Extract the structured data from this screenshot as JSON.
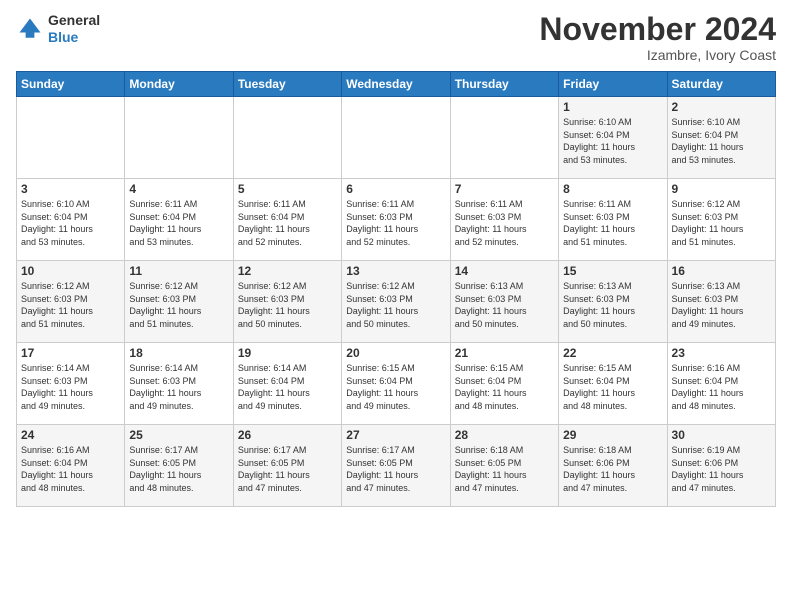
{
  "header": {
    "logo_general": "General",
    "logo_blue": "Blue",
    "month_title": "November 2024",
    "location": "Izambre, Ivory Coast"
  },
  "weekdays": [
    "Sunday",
    "Monday",
    "Tuesday",
    "Wednesday",
    "Thursday",
    "Friday",
    "Saturday"
  ],
  "weeks": [
    {
      "days": [
        {
          "num": "",
          "info": ""
        },
        {
          "num": "",
          "info": ""
        },
        {
          "num": "",
          "info": ""
        },
        {
          "num": "",
          "info": ""
        },
        {
          "num": "",
          "info": ""
        },
        {
          "num": "1",
          "info": "Sunrise: 6:10 AM\nSunset: 6:04 PM\nDaylight: 11 hours\nand 53 minutes."
        },
        {
          "num": "2",
          "info": "Sunrise: 6:10 AM\nSunset: 6:04 PM\nDaylight: 11 hours\nand 53 minutes."
        }
      ]
    },
    {
      "days": [
        {
          "num": "3",
          "info": "Sunrise: 6:10 AM\nSunset: 6:04 PM\nDaylight: 11 hours\nand 53 minutes."
        },
        {
          "num": "4",
          "info": "Sunrise: 6:11 AM\nSunset: 6:04 PM\nDaylight: 11 hours\nand 53 minutes."
        },
        {
          "num": "5",
          "info": "Sunrise: 6:11 AM\nSunset: 6:04 PM\nDaylight: 11 hours\nand 52 minutes."
        },
        {
          "num": "6",
          "info": "Sunrise: 6:11 AM\nSunset: 6:03 PM\nDaylight: 11 hours\nand 52 minutes."
        },
        {
          "num": "7",
          "info": "Sunrise: 6:11 AM\nSunset: 6:03 PM\nDaylight: 11 hours\nand 52 minutes."
        },
        {
          "num": "8",
          "info": "Sunrise: 6:11 AM\nSunset: 6:03 PM\nDaylight: 11 hours\nand 51 minutes."
        },
        {
          "num": "9",
          "info": "Sunrise: 6:12 AM\nSunset: 6:03 PM\nDaylight: 11 hours\nand 51 minutes."
        }
      ]
    },
    {
      "days": [
        {
          "num": "10",
          "info": "Sunrise: 6:12 AM\nSunset: 6:03 PM\nDaylight: 11 hours\nand 51 minutes."
        },
        {
          "num": "11",
          "info": "Sunrise: 6:12 AM\nSunset: 6:03 PM\nDaylight: 11 hours\nand 51 minutes."
        },
        {
          "num": "12",
          "info": "Sunrise: 6:12 AM\nSunset: 6:03 PM\nDaylight: 11 hours\nand 50 minutes."
        },
        {
          "num": "13",
          "info": "Sunrise: 6:12 AM\nSunset: 6:03 PM\nDaylight: 11 hours\nand 50 minutes."
        },
        {
          "num": "14",
          "info": "Sunrise: 6:13 AM\nSunset: 6:03 PM\nDaylight: 11 hours\nand 50 minutes."
        },
        {
          "num": "15",
          "info": "Sunrise: 6:13 AM\nSunset: 6:03 PM\nDaylight: 11 hours\nand 50 minutes."
        },
        {
          "num": "16",
          "info": "Sunrise: 6:13 AM\nSunset: 6:03 PM\nDaylight: 11 hours\nand 49 minutes."
        }
      ]
    },
    {
      "days": [
        {
          "num": "17",
          "info": "Sunrise: 6:14 AM\nSunset: 6:03 PM\nDaylight: 11 hours\nand 49 minutes."
        },
        {
          "num": "18",
          "info": "Sunrise: 6:14 AM\nSunset: 6:03 PM\nDaylight: 11 hours\nand 49 minutes."
        },
        {
          "num": "19",
          "info": "Sunrise: 6:14 AM\nSunset: 6:04 PM\nDaylight: 11 hours\nand 49 minutes."
        },
        {
          "num": "20",
          "info": "Sunrise: 6:15 AM\nSunset: 6:04 PM\nDaylight: 11 hours\nand 49 minutes."
        },
        {
          "num": "21",
          "info": "Sunrise: 6:15 AM\nSunset: 6:04 PM\nDaylight: 11 hours\nand 48 minutes."
        },
        {
          "num": "22",
          "info": "Sunrise: 6:15 AM\nSunset: 6:04 PM\nDaylight: 11 hours\nand 48 minutes."
        },
        {
          "num": "23",
          "info": "Sunrise: 6:16 AM\nSunset: 6:04 PM\nDaylight: 11 hours\nand 48 minutes."
        }
      ]
    },
    {
      "days": [
        {
          "num": "24",
          "info": "Sunrise: 6:16 AM\nSunset: 6:04 PM\nDaylight: 11 hours\nand 48 minutes."
        },
        {
          "num": "25",
          "info": "Sunrise: 6:17 AM\nSunset: 6:05 PM\nDaylight: 11 hours\nand 48 minutes."
        },
        {
          "num": "26",
          "info": "Sunrise: 6:17 AM\nSunset: 6:05 PM\nDaylight: 11 hours\nand 47 minutes."
        },
        {
          "num": "27",
          "info": "Sunrise: 6:17 AM\nSunset: 6:05 PM\nDaylight: 11 hours\nand 47 minutes."
        },
        {
          "num": "28",
          "info": "Sunrise: 6:18 AM\nSunset: 6:05 PM\nDaylight: 11 hours\nand 47 minutes."
        },
        {
          "num": "29",
          "info": "Sunrise: 6:18 AM\nSunset: 6:06 PM\nDaylight: 11 hours\nand 47 minutes."
        },
        {
          "num": "30",
          "info": "Sunrise: 6:19 AM\nSunset: 6:06 PM\nDaylight: 11 hours\nand 47 minutes."
        }
      ]
    }
  ]
}
